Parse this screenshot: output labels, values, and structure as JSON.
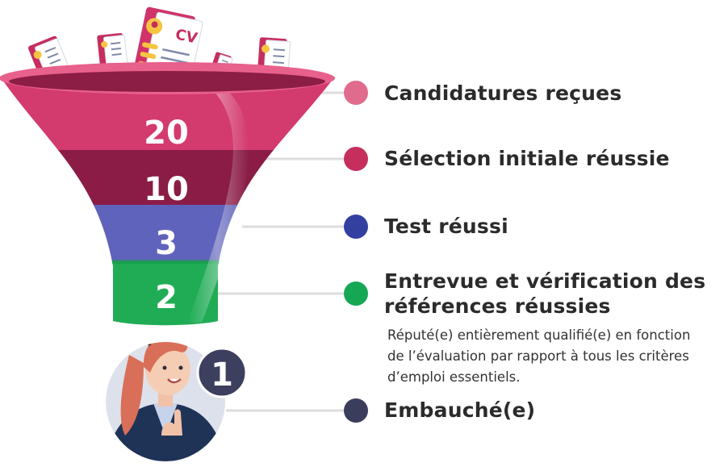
{
  "stages": [
    {
      "label": "Candidatures reçues",
      "count": "20",
      "dot_color": "#e06b8c",
      "band_color": "#d33a6e"
    },
    {
      "label": "Sélection initiale réussie",
      "count": "10",
      "dot_color": "#c62e5e",
      "band_color": "#8a1c45"
    },
    {
      "label": "Test réussi",
      "count": "3",
      "dot_color": "#3340a0",
      "band_color": "#5f63bb"
    },
    {
      "label": "Entrevue et vérification des références réussies",
      "label_lines": [
        "Entrevue et vérification des",
        "références réussies"
      ],
      "count": "2",
      "dot_color": "#16a755",
      "band_color": "#1fac55"
    },
    {
      "label": "Embauché(e)",
      "count": "1",
      "dot_color": "#3a3d5c"
    }
  ],
  "hired_description_lines": [
    "Réputé(e) entièrement qualifié(e) en fonction",
    "de l’évaluation par rapport à tous les critères",
    "d’emploi essentiels."
  ],
  "cv_card_text": "CV",
  "colors": {
    "connector_line": "#dddddd",
    "final_badge": "#3c3f5e",
    "avatar_bg": "#dde1ec",
    "hair": "#d96f58",
    "jacket": "#1f3357"
  }
}
